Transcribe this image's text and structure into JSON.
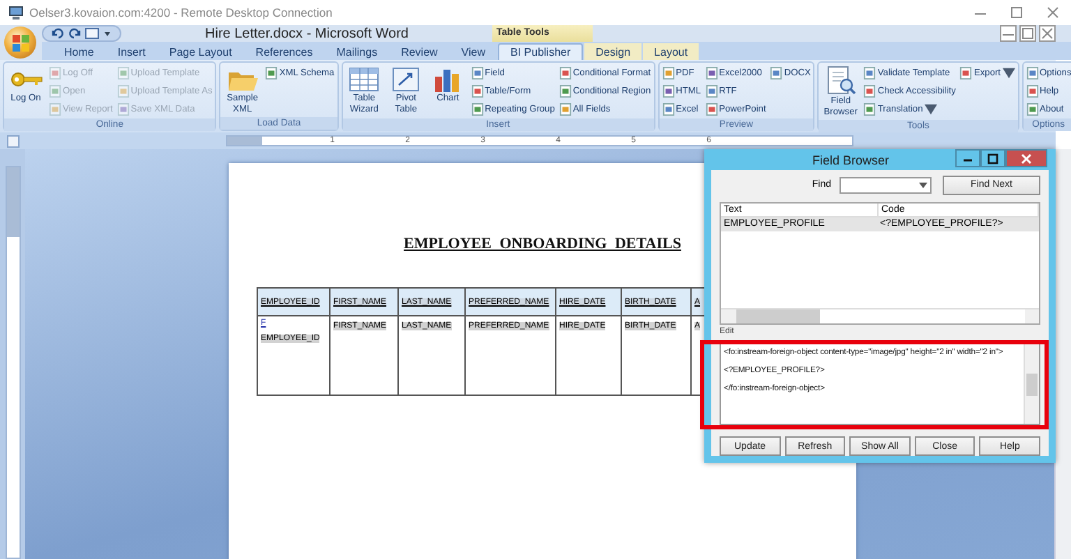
{
  "remote_desktop": {
    "title": "Oelser3.kovaion.com:4200 - Remote Desktop Connection"
  },
  "word": {
    "title": "Hire Letter.docx - Microsoft Word",
    "contextual_group": "Table Tools",
    "tabs": [
      {
        "label": "Home",
        "selected": false,
        "contextual": false
      },
      {
        "label": "Insert",
        "selected": false,
        "contextual": false
      },
      {
        "label": "Page Layout",
        "selected": false,
        "contextual": false
      },
      {
        "label": "References",
        "selected": false,
        "contextual": false
      },
      {
        "label": "Mailings",
        "selected": false,
        "contextual": false
      },
      {
        "label": "Review",
        "selected": false,
        "contextual": false
      },
      {
        "label": "View",
        "selected": false,
        "contextual": false
      },
      {
        "label": "BI Publisher",
        "selected": true,
        "contextual": false
      },
      {
        "label": "Design",
        "selected": false,
        "contextual": true
      },
      {
        "label": "Layout",
        "selected": false,
        "contextual": true
      }
    ],
    "ribbon": [
      {
        "label": "Online",
        "columns": [
          [
            {
              "label": "Log On",
              "kind": "large",
              "disabled": false
            }
          ],
          [
            {
              "label": "Log Off",
              "kind": "small",
              "disabled": true
            },
            {
              "label": "Open",
              "kind": "small",
              "disabled": true
            },
            {
              "label": "View Report",
              "kind": "small",
              "disabled": true
            }
          ],
          [
            {
              "label": "Upload Template",
              "kind": "small",
              "disabled": true
            },
            {
              "label": "Upload Template As",
              "kind": "small",
              "disabled": true
            },
            {
              "label": "Save XML Data",
              "kind": "small",
              "disabled": true
            }
          ]
        ]
      },
      {
        "label": "Load Data",
        "columns": [
          [
            {
              "label": "Sample XML",
              "kind": "large",
              "disabled": false
            }
          ],
          [
            {
              "label": "XML Schema",
              "kind": "small",
              "disabled": false
            }
          ]
        ]
      },
      {
        "label": "Insert",
        "columns": [
          [
            {
              "label": "Table Wizard",
              "kind": "large",
              "disabled": false
            }
          ],
          [
            {
              "label": "Pivot Table",
              "kind": "large",
              "disabled": false
            }
          ],
          [
            {
              "label": "Chart",
              "kind": "large",
              "disabled": false
            }
          ],
          [
            {
              "label": "Field",
              "kind": "small",
              "disabled": false
            },
            {
              "label": "Table/Form",
              "kind": "small",
              "disabled": false
            },
            {
              "label": "Repeating Group",
              "kind": "small",
              "disabled": false
            }
          ],
          [
            {
              "label": "Conditional Format",
              "kind": "small",
              "disabled": false
            },
            {
              "label": "Conditional Region",
              "kind": "small",
              "disabled": false
            },
            {
              "label": "All Fields",
              "kind": "small",
              "disabled": false
            }
          ]
        ]
      },
      {
        "label": "Preview",
        "columns": [
          [
            {
              "label": "PDF",
              "kind": "small",
              "disabled": false
            },
            {
              "label": "HTML",
              "kind": "small",
              "disabled": false
            },
            {
              "label": "Excel",
              "kind": "small",
              "disabled": false
            }
          ],
          [
            {
              "label": "Excel2000",
              "kind": "small",
              "disabled": false
            },
            {
              "label": "RTF",
              "kind": "small",
              "disabled": false
            },
            {
              "label": "PowerPoint",
              "kind": "small",
              "disabled": false
            }
          ],
          [
            {
              "label": "DOCX",
              "kind": "small",
              "disabled": false
            }
          ]
        ]
      },
      {
        "label": "Tools",
        "columns": [
          [
            {
              "label": "Field Browser",
              "kind": "large",
              "disabled": false
            }
          ],
          [
            {
              "label": "Validate Template",
              "kind": "small",
              "disabled": false
            },
            {
              "label": "Check Accessibility",
              "kind": "small",
              "disabled": false
            },
            {
              "label": "Translation",
              "kind": "small",
              "disabled": false,
              "dropdown": true
            }
          ],
          [
            {
              "label": "Export",
              "kind": "small",
              "disabled": false,
              "dropdown": true
            }
          ]
        ]
      },
      {
        "label": "Options",
        "columns": [
          [
            {
              "label": "Options",
              "kind": "small",
              "disabled": false
            },
            {
              "label": "Help",
              "kind": "small",
              "disabled": false
            },
            {
              "label": "About",
              "kind": "small",
              "disabled": false
            }
          ]
        ]
      }
    ],
    "ruler_numbers": [
      "1",
      "2",
      "3",
      "4",
      "5",
      "6"
    ]
  },
  "document": {
    "heading": "EMPLOYEE ONBOARDING DETAILS",
    "table": {
      "columns": [
        "EMPLOYEE_ID",
        "FIRST_NAME",
        "LAST_NAME",
        "PREFERRED_NAME",
        "HIRE_DATE",
        "BIRTH_DATE",
        "A"
      ],
      "rows": [
        {
          "cells": [
            [
              {
                "text": "F",
                "kind": "marker"
              },
              {
                "text": "EMPLOYEE_ID",
                "kind": "field"
              }
            ],
            [
              {
                "text": "FIRST_NAME",
                "kind": "field"
              }
            ],
            [
              {
                "text": "LAST_NAME",
                "kind": "field"
              }
            ],
            [
              {
                "text": "PREFERRED_NAME",
                "kind": "field"
              }
            ],
            [
              {
                "text": "HIRE_DATE",
                "kind": "field"
              }
            ],
            [
              {
                "text": "BIRTH_DATE",
                "kind": "field"
              }
            ],
            [
              {
                "text": "A",
                "kind": "field"
              }
            ]
          ]
        }
      ]
    }
  },
  "field_browser": {
    "title": "Field Browser",
    "find_label": "Find",
    "find_button": "Find Next",
    "list": {
      "columns": [
        "Text",
        "Code"
      ],
      "rows": [
        {
          "cells": [
            "EMPLOYEE_PROFILE",
            "<?EMPLOYEE_PROFILE?>"
          ],
          "selected": true
        }
      ]
    },
    "edit_label": "Edit",
    "edit_lines": [
      "<fo:instream-foreign-object content-type=\"image/jpg\" height=\"2 in\" width=\"2 in\">",
      "<?EMPLOYEE_PROFILE?>",
      "</fo:instream-foreign-object>"
    ],
    "buttons": [
      "Update",
      "Refresh",
      "Show All",
      "Close",
      "Help"
    ]
  }
}
